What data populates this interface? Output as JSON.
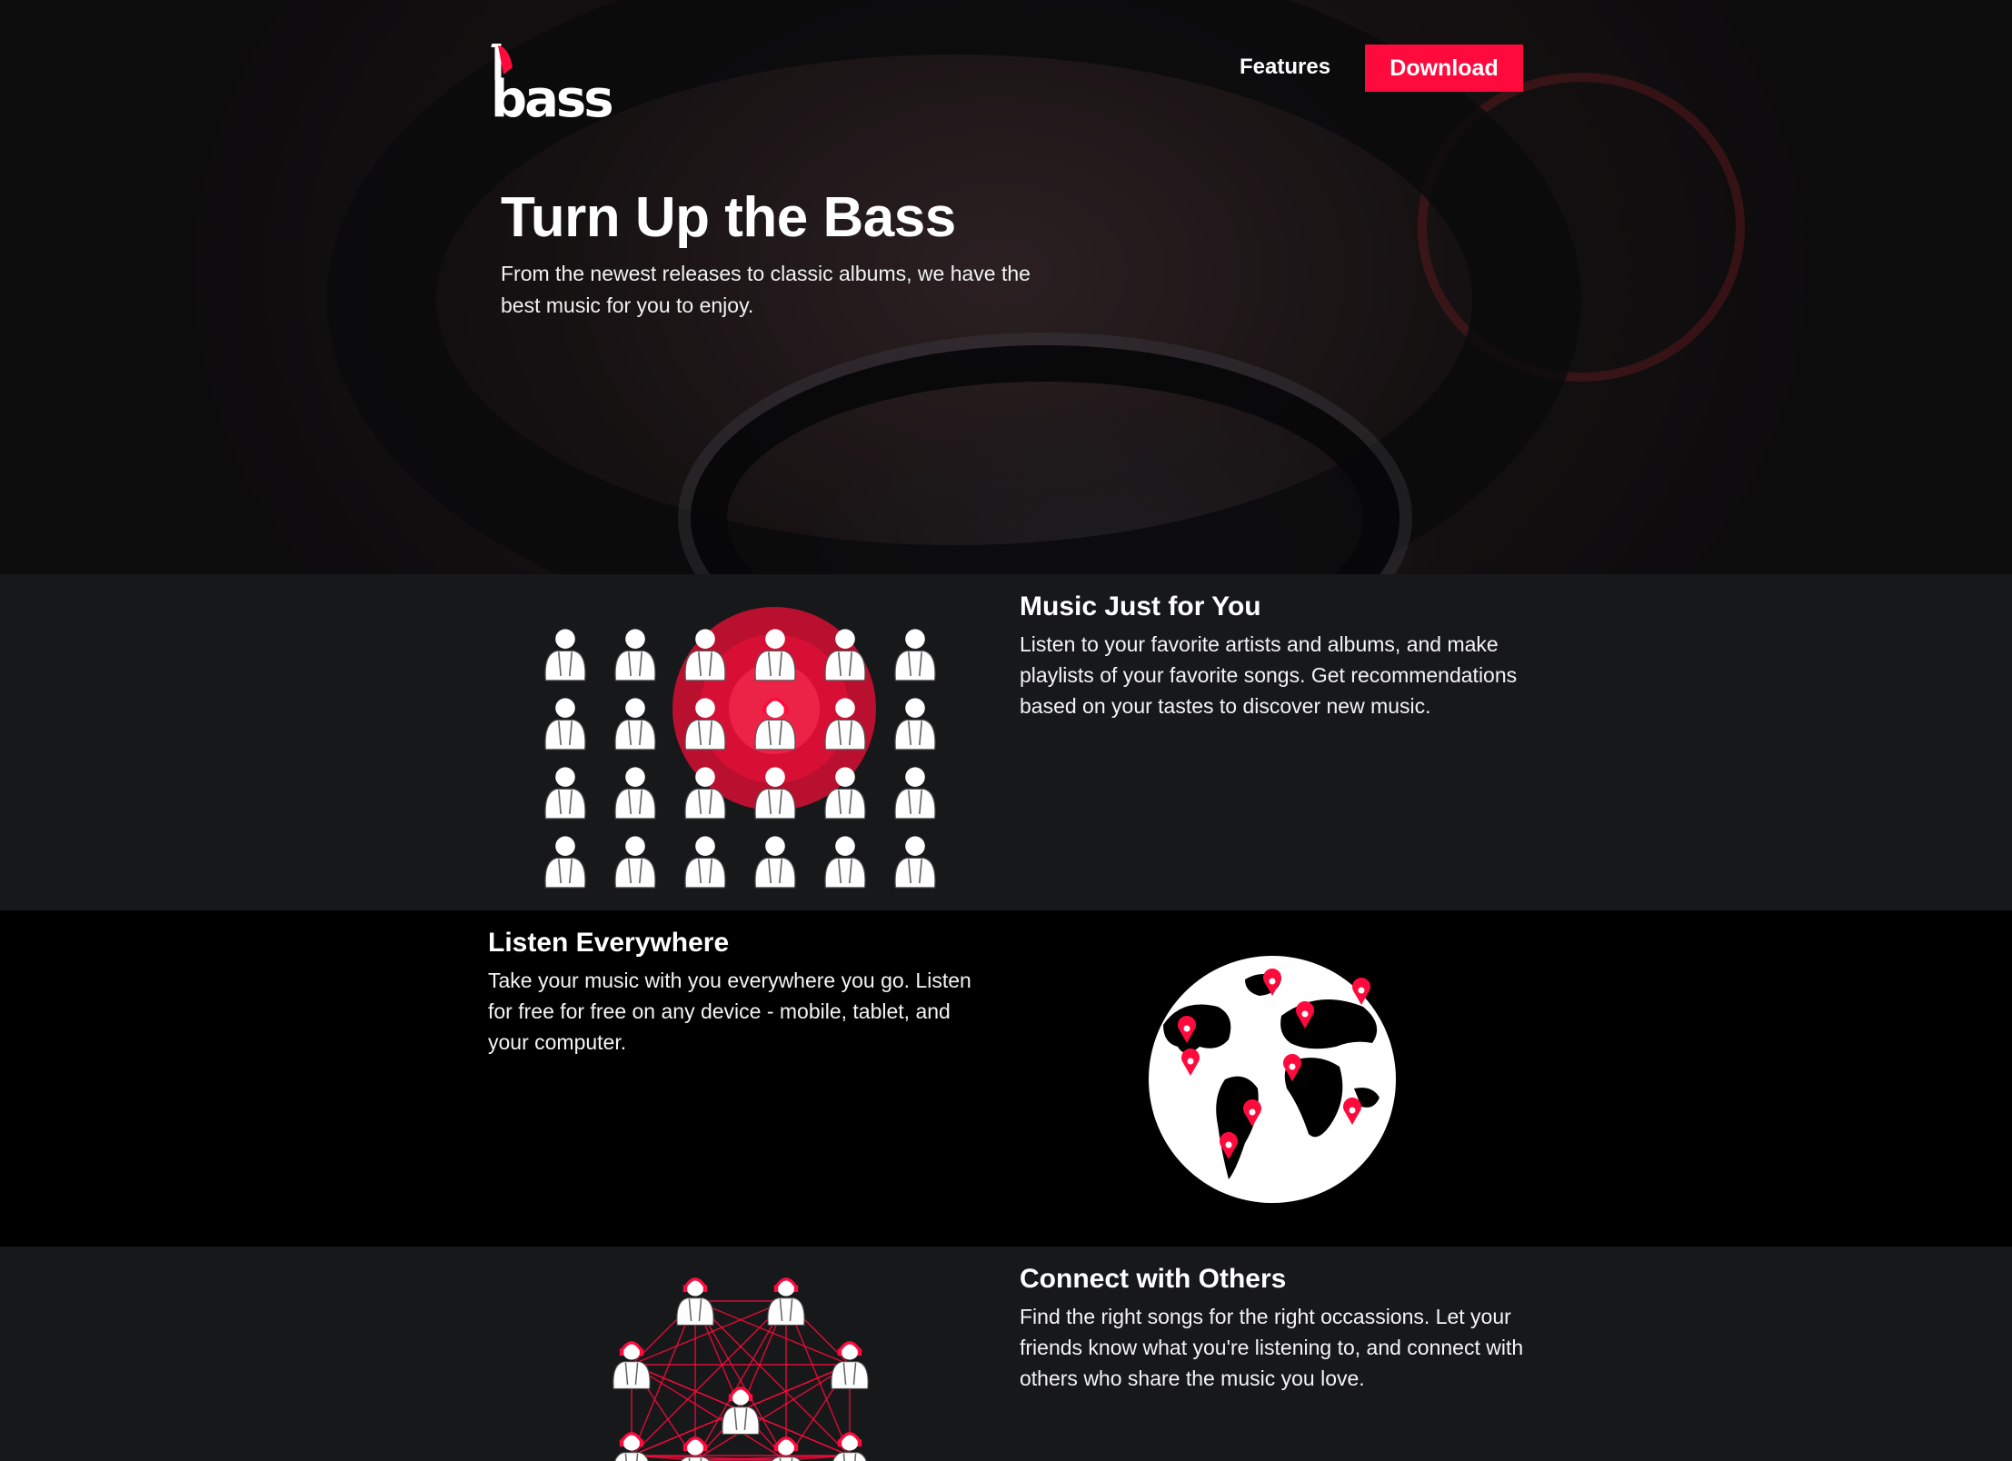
{
  "header": {
    "logo_text": "bass",
    "nav": {
      "features_label": "Features",
      "download_label": "Download"
    }
  },
  "hero": {
    "title": "Turn Up the Bass",
    "subtitle": "From the newest releases to classic albums, we have the best music for you to enjoy."
  },
  "features": [
    {
      "title": "Music Just for You",
      "body": "Listen to your favorite artists and albums, and make playlists of your favorite songs. Get recommendations based on your tastes to discover new music.",
      "illustration": "target-crowd-illustration"
    },
    {
      "title": "Listen Everywhere",
      "body": "Take your music with you everywhere you go. Listen for free for free on any device - mobile, tablet, and your computer.",
      "illustration": "globe-pins-illustration"
    },
    {
      "title": "Connect with Others",
      "body": "Find the right songs for the right occassions. Let your friends know what you're listening to, and connect with others who share the music you love.",
      "illustration": "network-people-illustration"
    }
  ],
  "colors": {
    "accent": "#ff0a3c",
    "dark_section": "#17181a",
    "black_section": "#000000"
  }
}
